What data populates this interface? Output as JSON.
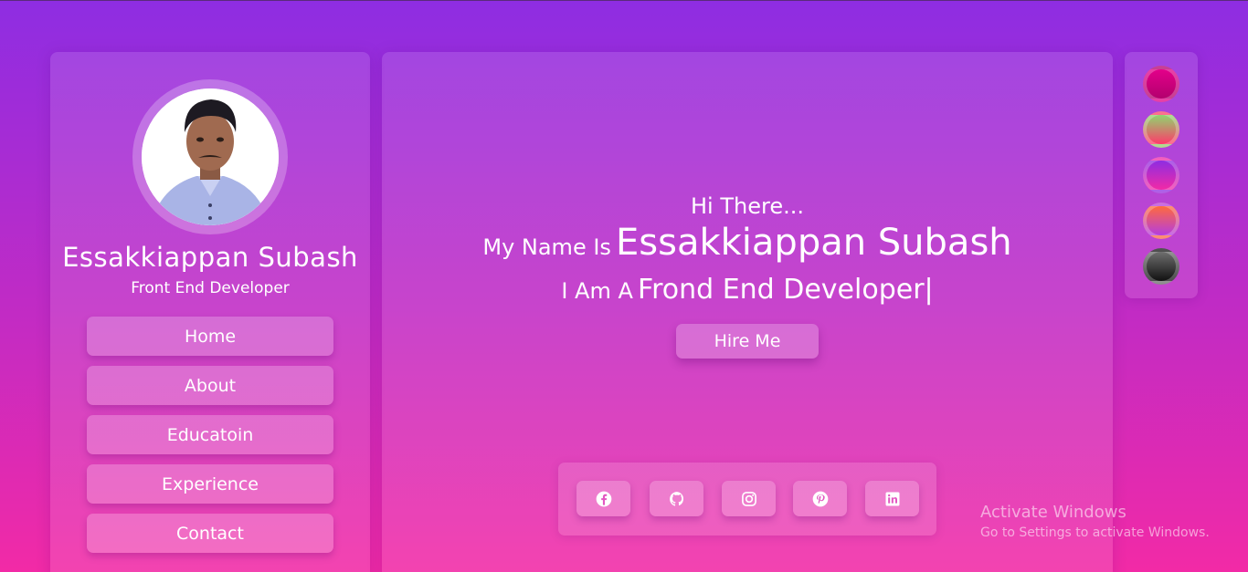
{
  "profile": {
    "name": "Essakkiappan Subash",
    "role": "Front End Developer"
  },
  "nav": {
    "items": [
      "Home",
      "About",
      "Educatoin",
      "Experience",
      "Contact"
    ]
  },
  "hero": {
    "greeting": "Hi There...",
    "intro_prefix": "My Name Is",
    "intro_name": "Essakkiappan Subash",
    "role_prefix": "I Am A",
    "role_text": "Frond End Developer|",
    "hire_label": "Hire Me"
  },
  "social": {
    "icons": [
      "facebook-icon",
      "github-icon",
      "instagram-icon",
      "pinterest-icon",
      "linkedin-icon"
    ]
  },
  "themes": {
    "swatches": [
      "linear-gradient(180deg,#e3008a,#b3006e)",
      "linear-gradient(180deg,#8fd66e,#ff3a6a)",
      "linear-gradient(180deg,#8e2de2,#f22aa6)",
      "linear-gradient(180deg,#ff6a3d,#b43de0)",
      "linear-gradient(180deg,#6f6f6f,#111111)"
    ]
  },
  "watermark": {
    "line1": "Activate Windows",
    "line2": "Go to Settings to activate Windows."
  },
  "colors": {
    "bg_top": "#8e2de2",
    "bg_bottom": "#f22aa6"
  }
}
